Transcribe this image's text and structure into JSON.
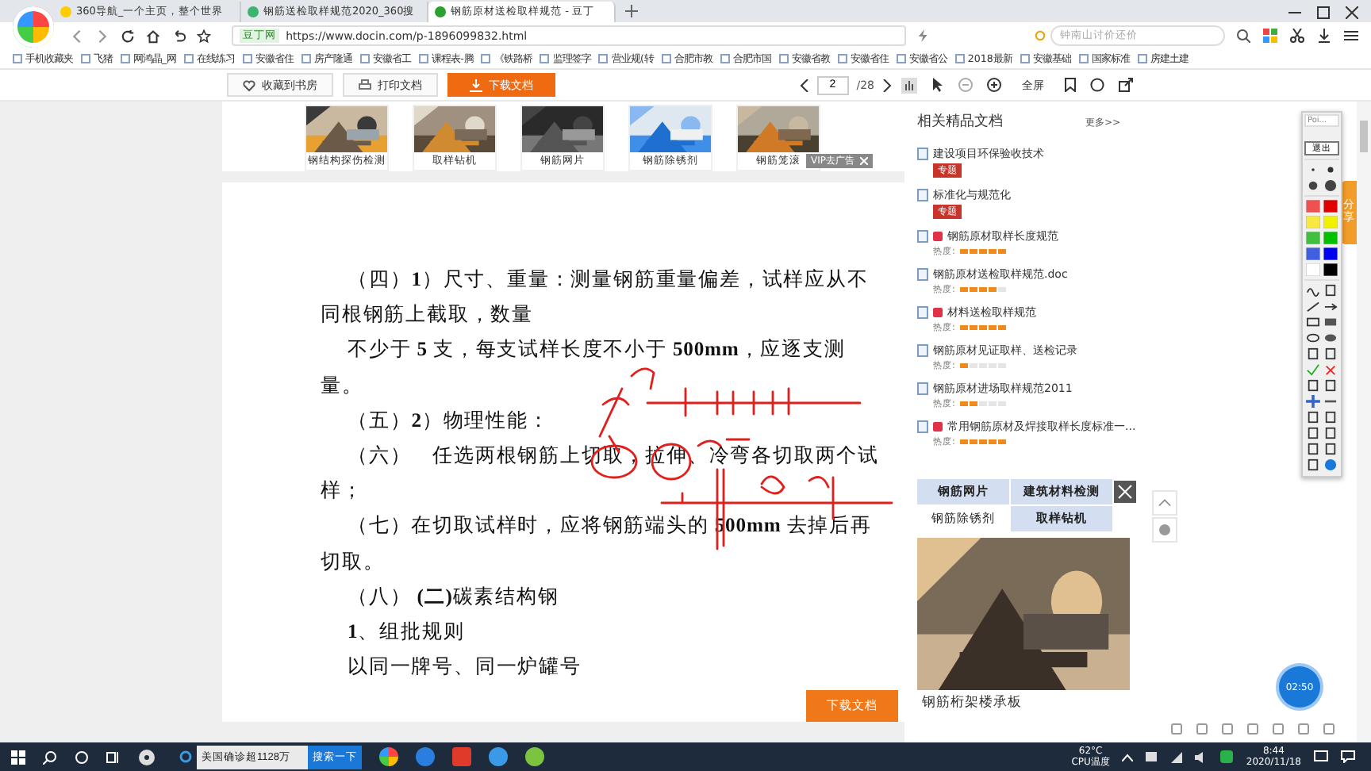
{
  "browser": {
    "tabs": [
      {
        "title": "360导航_一个主页，整个世界",
        "selected": false
      },
      {
        "title": "钢筋送检取样规范2020_360搜",
        "selected": false
      },
      {
        "title": "钢筋原材送检取样规范 - 豆丁",
        "selected": true
      }
    ],
    "site_badge": "豆丁网",
    "url": "https://www.docin.com/p-1896099832.html",
    "search_placeholder": "钟南山讨价还价",
    "bookmarks": [
      "手机收藏夹",
      "飞猪",
      "网鸿晶_网",
      "在线练习",
      "安徽省住",
      "房产隆通",
      "安徽省工",
      "课程表-腾",
      "《铁路桥",
      "监理签字",
      "营业规(转",
      "合肥市教",
      "合肥市国",
      "安徽省教",
      "安徽省住",
      "安徽省公",
      "2018最新",
      "安徽基础",
      "国家标准",
      "房建土建"
    ]
  },
  "toolbar": {
    "favorite": "收藏到书房",
    "print": "打印文档",
    "download": "下载文档",
    "page": "2",
    "page_total": "/28",
    "fullscreen": "全屏"
  },
  "recommend": {
    "items": [
      {
        "caption": "钢结构探伤检测",
        "kind": "picture"
      },
      {
        "caption": "取样钻机",
        "kind": "picture"
      },
      {
        "caption": "钢筋网片",
        "kind": "picture"
      },
      {
        "caption": "钢筋除锈剂",
        "kind": "picture"
      },
      {
        "caption": "钢筋笼滚",
        "kind": "picture"
      }
    ],
    "ad_badge": "VIP去广告"
  },
  "document": {
    "paragraphs": [
      {
        "lines": [
          "（四）**1**）尺寸、重量：测量钢筋重量偏差，试样应从不",
          "同根钢筋上截取，数量"
        ]
      },
      {
        "lines": [
          "不少于 **5** 支，每支试样长度不小于 **500mm**，应逐支测",
          "量。"
        ]
      },
      {
        "lines": [
          "（五）**2**）物理性能："
        ]
      },
      {
        "lines": [
          "（六）　任选两根钢筋上切取，拉伸、冷弯各切取两个试",
          "样；"
        ]
      },
      {
        "lines": [
          "（七）在切取试样时，应将钢筋端头的 **500mm** 去掉后再",
          "切取。"
        ]
      },
      {
        "lines": [
          "（八）  **(二)**碳素结构钢"
        ]
      },
      {
        "lines": [
          "**1**、组批规则"
        ]
      },
      {
        "lines": [
          "以同一牌号、同一炉罐号"
        ]
      }
    ],
    "download": "下载文档"
  },
  "related": {
    "title": "相关精品文档",
    "more": "更多>>",
    "items": [
      {
        "kind": "topic",
        "title": "建设项目环保验收技术",
        "vip": false,
        "tag": "专题"
      },
      {
        "kind": "topic",
        "title": "标准化与规范化",
        "vip": false,
        "tag": "专题"
      },
      {
        "kind": "doc",
        "title": "钢筋原材取样长度规范",
        "vip": true,
        "heat": "热度:",
        "stars": 5
      },
      {
        "kind": "doc",
        "title": "钢筋原材送检取样规范.doc",
        "vip": false,
        "heat": "热度:",
        "stars": 4
      },
      {
        "kind": "doc",
        "title": "材料送检取样规范",
        "vip": true,
        "heat": "热度:",
        "stars": 5
      },
      {
        "kind": "doc",
        "title": "钢筋原材见证取样、送检记录",
        "vip": false,
        "heat": "热度:",
        "stars": 1
      },
      {
        "kind": "doc",
        "title": "钢筋原材进场取样规范2011",
        "vip": false,
        "heat": "热度:",
        "stars": 2
      },
      {
        "kind": "doc",
        "title": "常用钢筋原材及焊接取样长度标准一...",
        "vip": true,
        "heat": "热度:",
        "stars": 5
      }
    ]
  },
  "pen_tool": {
    "title": "Poi...",
    "exit": "退出"
  },
  "share": "分享",
  "ad": {
    "tabs": [
      {
        "label": "钢筋网片",
        "selected": false
      },
      {
        "label": "建筑材料检测",
        "selected": false
      },
      {
        "label": "钢筋除锈剂",
        "selected": true
      },
      {
        "label": "取样钻机",
        "selected": false
      }
    ],
    "caption": "钢筋桁架楼承板"
  },
  "timer": "02:50",
  "taskbar": {
    "search_value": "美国确诊超1128万",
    "search_button": "搜索一下",
    "temp": "62°C",
    "temp_label": "CPU温度",
    "time": "8:44",
    "date": "2020/11/18"
  }
}
